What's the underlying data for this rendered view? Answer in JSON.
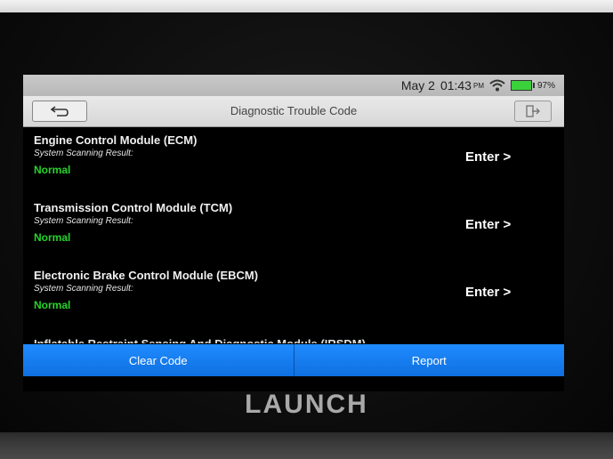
{
  "status": {
    "date": "May 2",
    "time": "01:43",
    "ampm": "PM",
    "battery": "97%"
  },
  "header": {
    "title": "Diagnostic Trouble Code"
  },
  "modules": [
    {
      "name": "Engine Control Module (ECM)",
      "scan_label": "System Scanning Result:",
      "result": "Normal",
      "enter_label": "Enter >"
    },
    {
      "name": "Transmission Control Module (TCM)",
      "scan_label": "System Scanning Result:",
      "result": "Normal",
      "enter_label": "Enter >"
    },
    {
      "name": "Electronic Brake Control Module (EBCM)",
      "scan_label": "System Scanning Result:",
      "result": "Normal",
      "enter_label": "Enter >"
    }
  ],
  "partial_module": "Inflatable Restraint Sensing And Diagnostic Module (IRSDM)",
  "actions": {
    "clear_code": "Clear Code",
    "report": "Report"
  },
  "brand": "LAUNCH",
  "colors": {
    "accent": "#1f8cff",
    "normal_status": "#27d32b"
  }
}
